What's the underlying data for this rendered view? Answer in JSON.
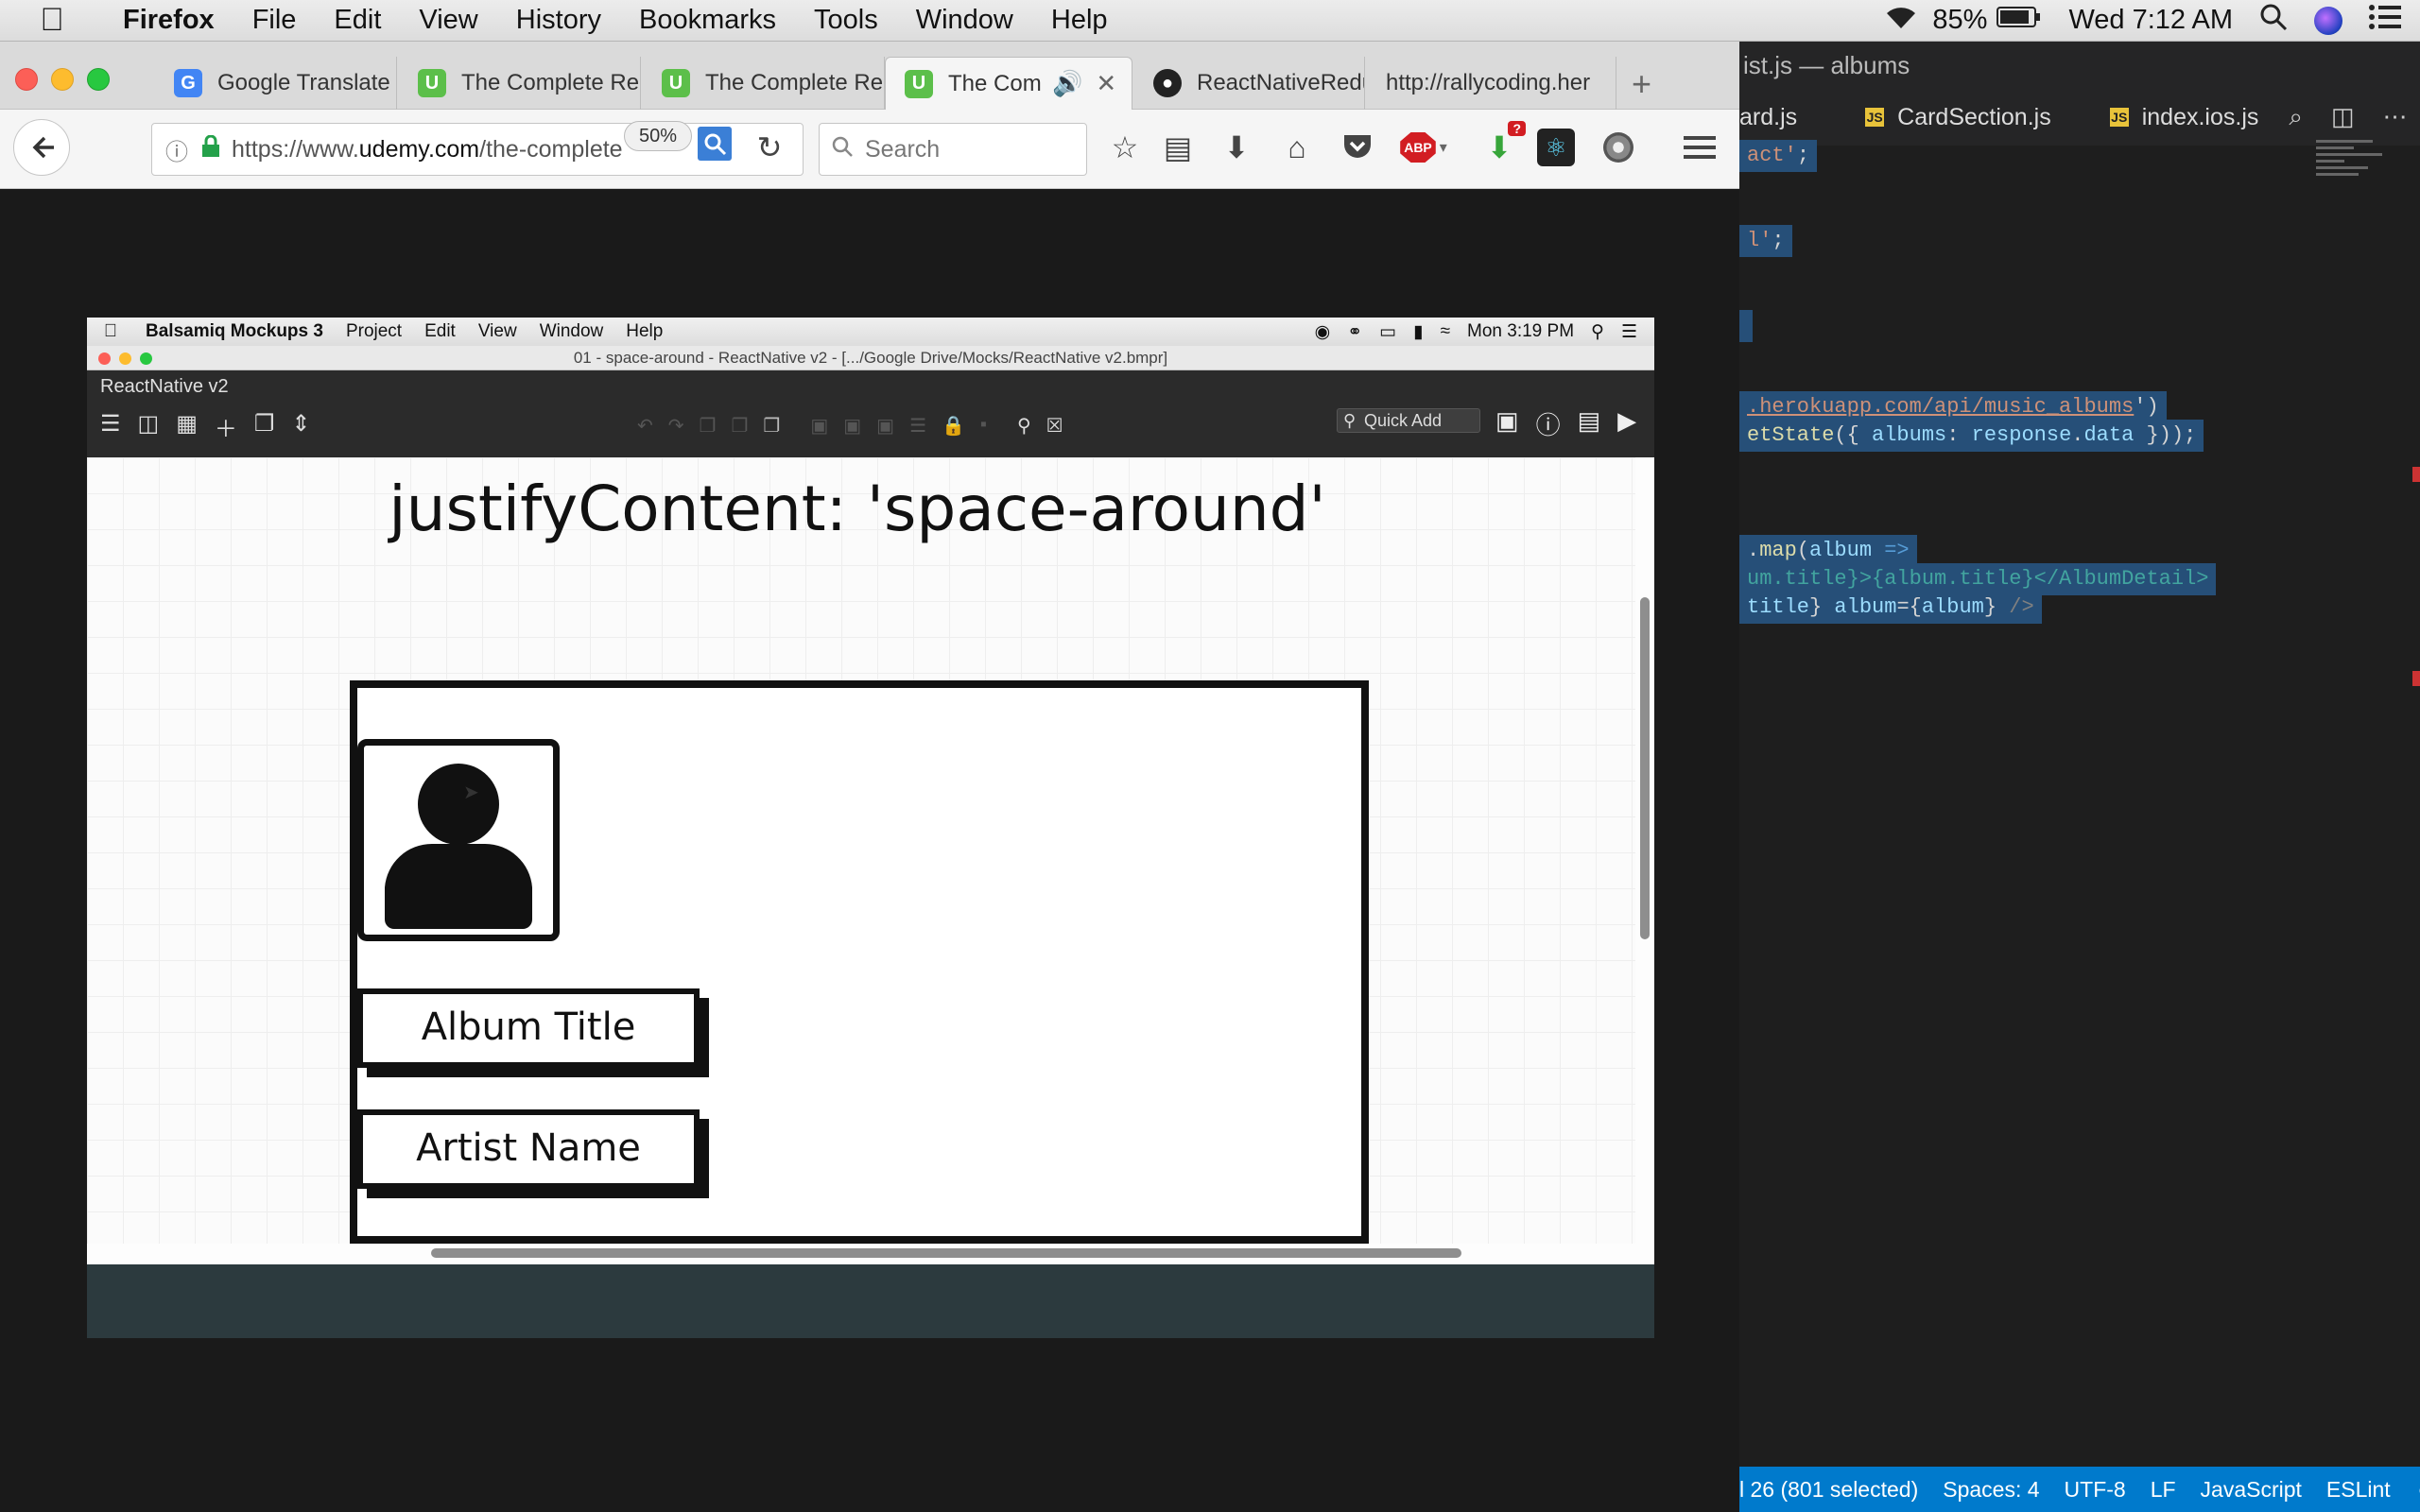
{
  "macos_menubar": {
    "app": "Firefox",
    "menus": [
      "File",
      "Edit",
      "View",
      "History",
      "Bookmarks",
      "Tools",
      "Window",
      "Help"
    ],
    "battery": "85%",
    "clock": "Wed 7:12 AM"
  },
  "firefox": {
    "tabs": [
      {
        "title": "Google Translate",
        "favicon": "G",
        "color": "#4285f4"
      },
      {
        "title": "The Complete Re",
        "favicon": "U",
        "color": "#5cbf4a"
      },
      {
        "title": "The Complete Re",
        "favicon": "U",
        "color": "#5cbf4a"
      },
      {
        "title": "The Comp",
        "favicon": "U",
        "color": "#5cbf4a",
        "active": true
      },
      {
        "title": "ReactNativeRedu",
        "favicon": "gh",
        "color": "#222222"
      },
      {
        "title": "http://rallycoding.her",
        "favicon": "",
        "color": ""
      }
    ],
    "url_prefix": "https://www.",
    "url_domain": "udemy.com",
    "url_rest": "/the-complete",
    "zoom": "50%",
    "search_placeholder": "Search",
    "abp_badge": "ABP"
  },
  "balsamiq": {
    "app": "Balsamiq Mockups 3",
    "menus": [
      "Project",
      "Edit",
      "View",
      "Window",
      "Help"
    ],
    "clock": "Mon 3:19 PM",
    "window_title": "01 - space-around - ReactNative v2 - [.../Google Drive/Mocks/ReactNative v2.bmpr]",
    "project_name": "ReactNative v2",
    "quick_add": "Quick Add",
    "mockup_title": "justifyContent: 'space-around'",
    "album_title": "Album Title",
    "artist_name": "Artist Name"
  },
  "editor": {
    "window_title": "ist.js — albums",
    "tabs": [
      "ard.js",
      "CardSection.js",
      "index.ios.js"
    ],
    "status": {
      "position": "l 26 (801 selected)",
      "spaces": "Spaces: 4",
      "encoding": "UTF-8",
      "eol": "LF",
      "language": "JavaScript",
      "linter": "ESLint"
    }
  }
}
